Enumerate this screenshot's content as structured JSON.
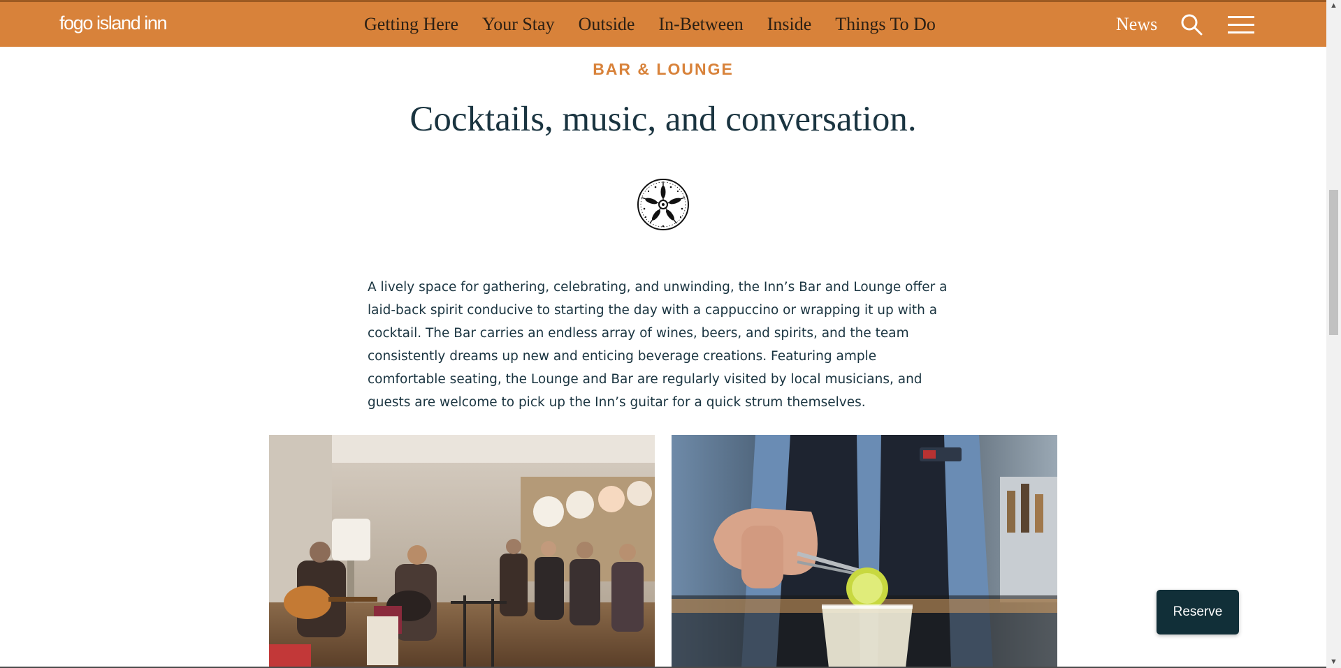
{
  "brand": {
    "logo_text": "fogo island inn",
    "accent_color": "#d8823a",
    "dark_color": "#112f38"
  },
  "nav": {
    "items": [
      "Getting Here",
      "Your Stay",
      "Outside",
      "In-Between",
      "Inside",
      "Things To Do"
    ],
    "news_label": "News",
    "search_icon": "search-icon",
    "menu_icon": "hamburger-menu-icon"
  },
  "section": {
    "eyebrow": "BAR & LOUNGE",
    "headline": "Cocktails, music, and conversation.",
    "emblem_icon": "sea-urchin-emblem-icon",
    "body": "A lively space for gathering, celebrating, and unwinding, the Inn’s Bar and Lounge offer a laid-back spirit conducive to starting the day with a cappuccino or wrapping it up with a cocktail. The Bar carries an endless array of wines, beers, and spirits, and the team consistently dreams up new and enticing beverage creations. Featuring ample comfortable seating, the Lounge and Bar are regularly visited by local musicians, and guests are welcome to pick up the Inn’s guitar for a quick strum themselves."
  },
  "cta": {
    "reserve_label": "Reserve"
  }
}
